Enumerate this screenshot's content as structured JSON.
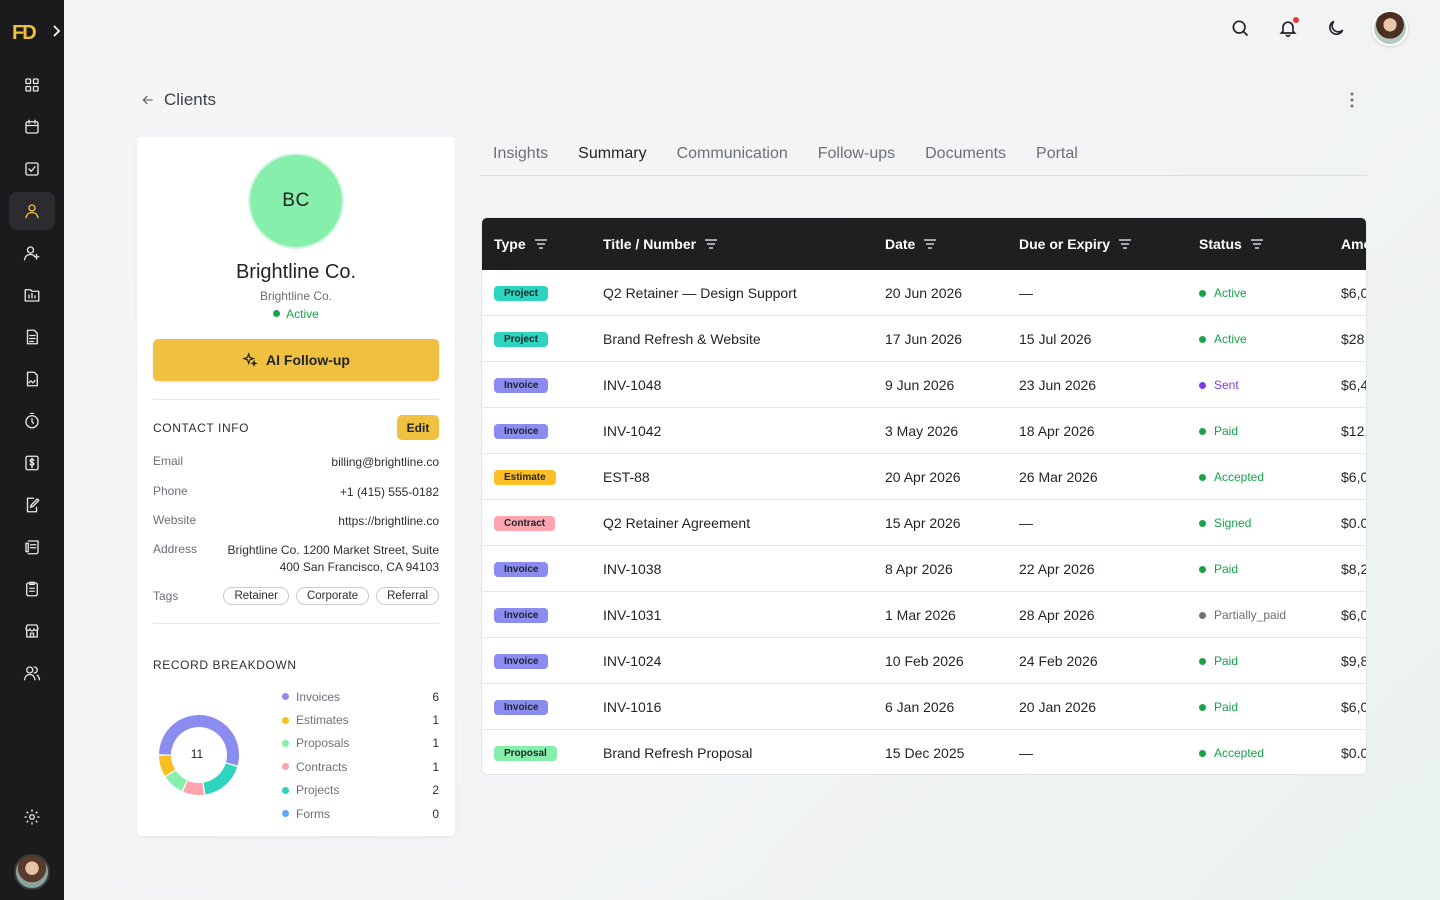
{
  "app": {
    "logo_text": "FD"
  },
  "sidebar": {
    "items": [
      {
        "name": "dashboard",
        "icon": "grid-icon"
      },
      {
        "name": "calendar",
        "icon": "calendar-icon"
      },
      {
        "name": "tasks",
        "icon": "checkbox-icon"
      },
      {
        "name": "clients",
        "icon": "user-icon",
        "active": true
      },
      {
        "name": "add-user",
        "icon": "user-plus-icon"
      },
      {
        "name": "projects",
        "icon": "folder-icon"
      },
      {
        "name": "documents",
        "icon": "file-text-icon"
      },
      {
        "name": "contracts",
        "icon": "file-signature-icon"
      },
      {
        "name": "time",
        "icon": "stopwatch-icon"
      },
      {
        "name": "invoices",
        "icon": "dollar-doc-icon"
      },
      {
        "name": "estimates",
        "icon": "edit-doc-icon"
      },
      {
        "name": "receipts",
        "icon": "receipt-icon"
      },
      {
        "name": "forms",
        "icon": "clipboard-icon"
      },
      {
        "name": "store",
        "icon": "store-icon"
      },
      {
        "name": "team",
        "icon": "users-icon"
      }
    ]
  },
  "header": {
    "back_label": "Clients"
  },
  "client": {
    "initials": "BC",
    "name": "Brightline Co.",
    "company": "Brightline Co.",
    "status": "Active",
    "ai_button": "AI Follow-up",
    "contact_title": "CONTACT INFO",
    "edit_label": "Edit",
    "email_label": "Email",
    "email": "billing@brightline.co",
    "phone_label": "Phone",
    "phone": "+1 (415) 555-0182",
    "website_label": "Website",
    "website": "https://brightline.co",
    "address_label": "Address",
    "address_line1": "Brightline Co. 1200 Market Street, Suite",
    "address_line2": "400 San Francisco, CA 94103",
    "tags_label": "Tags",
    "tags": [
      "Retainer",
      "Corporate",
      "Referral"
    ]
  },
  "breakdown": {
    "title": "RECORD BREAKDOWN",
    "total": "11",
    "items": [
      {
        "label": "Invoices",
        "count": 6,
        "color": "#8b8cf0"
      },
      {
        "label": "Estimates",
        "count": 1,
        "color": "#fbbf24"
      },
      {
        "label": "Proposals",
        "count": 1,
        "color": "#86efac"
      },
      {
        "label": "Contracts",
        "count": 1,
        "color": "#fda4af"
      },
      {
        "label": "Projects",
        "count": 2,
        "color": "#2dd4bf"
      },
      {
        "label": "Forms",
        "count": 0,
        "color": "#60a5fa"
      }
    ]
  },
  "tabs": [
    "Insights",
    "Summary",
    "Communication",
    "Follow-ups",
    "Documents",
    "Portal"
  ],
  "table": {
    "columns": [
      "Type",
      "Title / Number",
      "Date",
      "Due or Expiry",
      "Status",
      "Amo"
    ],
    "rows": [
      {
        "type": "Project",
        "title": "Q2 Retainer — Design Support",
        "date": "20 Jun 2026",
        "due": "—",
        "status": "Active",
        "amount": "$6,0"
      },
      {
        "type": "Project",
        "title": "Brand Refresh & Website",
        "date": "17 Jun 2026",
        "due": "15 Jul 2026",
        "status": "Active",
        "amount": "$28"
      },
      {
        "type": "Invoice",
        "title": "INV-1048",
        "date": "9 Jun 2026",
        "due": "23 Jun 2026",
        "status": "Sent",
        "amount": "$6,4"
      },
      {
        "type": "Invoice",
        "title": "INV-1042",
        "date": "3 May 2026",
        "due": "18 Apr 2026",
        "status": "Paid",
        "amount": "$12,"
      },
      {
        "type": "Estimate",
        "title": "EST-88",
        "date": "20 Apr 2026",
        "due": "26 Mar 2026",
        "status": "Accepted",
        "amount": "$6,0"
      },
      {
        "type": "Contract",
        "title": "Q2 Retainer Agreement",
        "date": "15 Apr 2026",
        "due": "—",
        "status": "Signed",
        "amount": "$0.0"
      },
      {
        "type": "Invoice",
        "title": "INV-1038",
        "date": "8 Apr 2026",
        "due": "22 Apr 2026",
        "status": "Paid",
        "amount": "$8,2"
      },
      {
        "type": "Invoice",
        "title": "INV-1031",
        "date": "1 Mar 2026",
        "due": "28 Apr 2026",
        "status": "Partially_paid",
        "amount": "$6,0"
      },
      {
        "type": "Invoice",
        "title": "INV-1024",
        "date": "10 Feb 2026",
        "due": "24 Feb 2026",
        "status": "Paid",
        "amount": "$9,8"
      },
      {
        "type": "Invoice",
        "title": "INV-1016",
        "date": "6 Jan 2026",
        "due": "20 Jan 2026",
        "status": "Paid",
        "amount": "$6,0"
      },
      {
        "type": "Proposal",
        "title": "Brand Refresh Proposal",
        "date": "15 Dec 2025",
        "due": "—",
        "status": "Accepted",
        "amount": "$0.0"
      }
    ]
  },
  "colors": {
    "accent": "#f0c040",
    "badge": {
      "Project": "#2dd4bf",
      "Invoice": "#8b8cf0",
      "Estimate": "#fbbf24",
      "Contract": "#fda4af",
      "Proposal": "#86efac"
    },
    "status": {
      "Active": "#16a34a",
      "Sent": "#7c3aed",
      "Paid": "#16a34a",
      "Accepted": "#16a34a",
      "Signed": "#16a34a",
      "Partially_paid": "#6b7079"
    },
    "status_text": {
      "Active": "#16a34a",
      "Sent": "#7c3aed",
      "Paid": "#16a34a",
      "Accepted": "#16a34a",
      "Signed": "#16a34a",
      "Partially_paid": "#6b7079"
    }
  }
}
